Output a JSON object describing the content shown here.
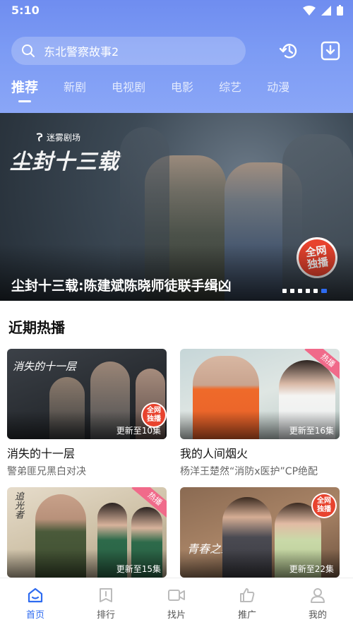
{
  "status": {
    "time": "5:10"
  },
  "search": {
    "query": "东北警察故事2"
  },
  "tabs": [
    {
      "label": "推荐",
      "active": true
    },
    {
      "label": "新剧"
    },
    {
      "label": "电视剧"
    },
    {
      "label": "电影"
    },
    {
      "label": "综艺"
    },
    {
      "label": "动漫"
    }
  ],
  "banner": {
    "logo_text": "迷雾剧场",
    "calligraphy": "尘封十三载",
    "title": "尘封十三载:陈建斌陈晓师徒联手缉凶",
    "badge_line1": "全网",
    "badge_line2": "独播",
    "slide_count": 6,
    "active_slide": 6
  },
  "section": {
    "title": "近期热播"
  },
  "cards": [
    {
      "title": "消失的十一层",
      "subtitle": "警弟匪兄黑白对决",
      "update": "更新至10集",
      "thumb_text": "消失的十一层",
      "badge_line1": "全网",
      "badge_line2": "独播"
    },
    {
      "title": "我的人间烟火",
      "subtitle": "杨洋王楚然“消防x医护”CP绝配",
      "update": "更新至16集",
      "corner": "热播"
    },
    {
      "title": "",
      "subtitle": "",
      "update": "更新至15集",
      "corner": "热播",
      "thumb_text": "追光者"
    },
    {
      "title": "",
      "subtitle": "",
      "update": "更新至22集",
      "thumb_text": "青春之约",
      "badge_line1": "全网",
      "badge_line2": "独播"
    }
  ],
  "nav": [
    {
      "label": "首页",
      "icon": "home-icon",
      "active": true
    },
    {
      "label": "排行",
      "icon": "ranking-icon"
    },
    {
      "label": "找片",
      "icon": "video-camera-icon"
    },
    {
      "label": "推广",
      "icon": "thumbs-up-icon"
    },
    {
      "label": "我的",
      "icon": "person-icon"
    }
  ],
  "colors": {
    "accent": "#2e6bf0",
    "header": "#7c9bf4",
    "badge": "#e8432e",
    "corner": "#f06a8a"
  }
}
